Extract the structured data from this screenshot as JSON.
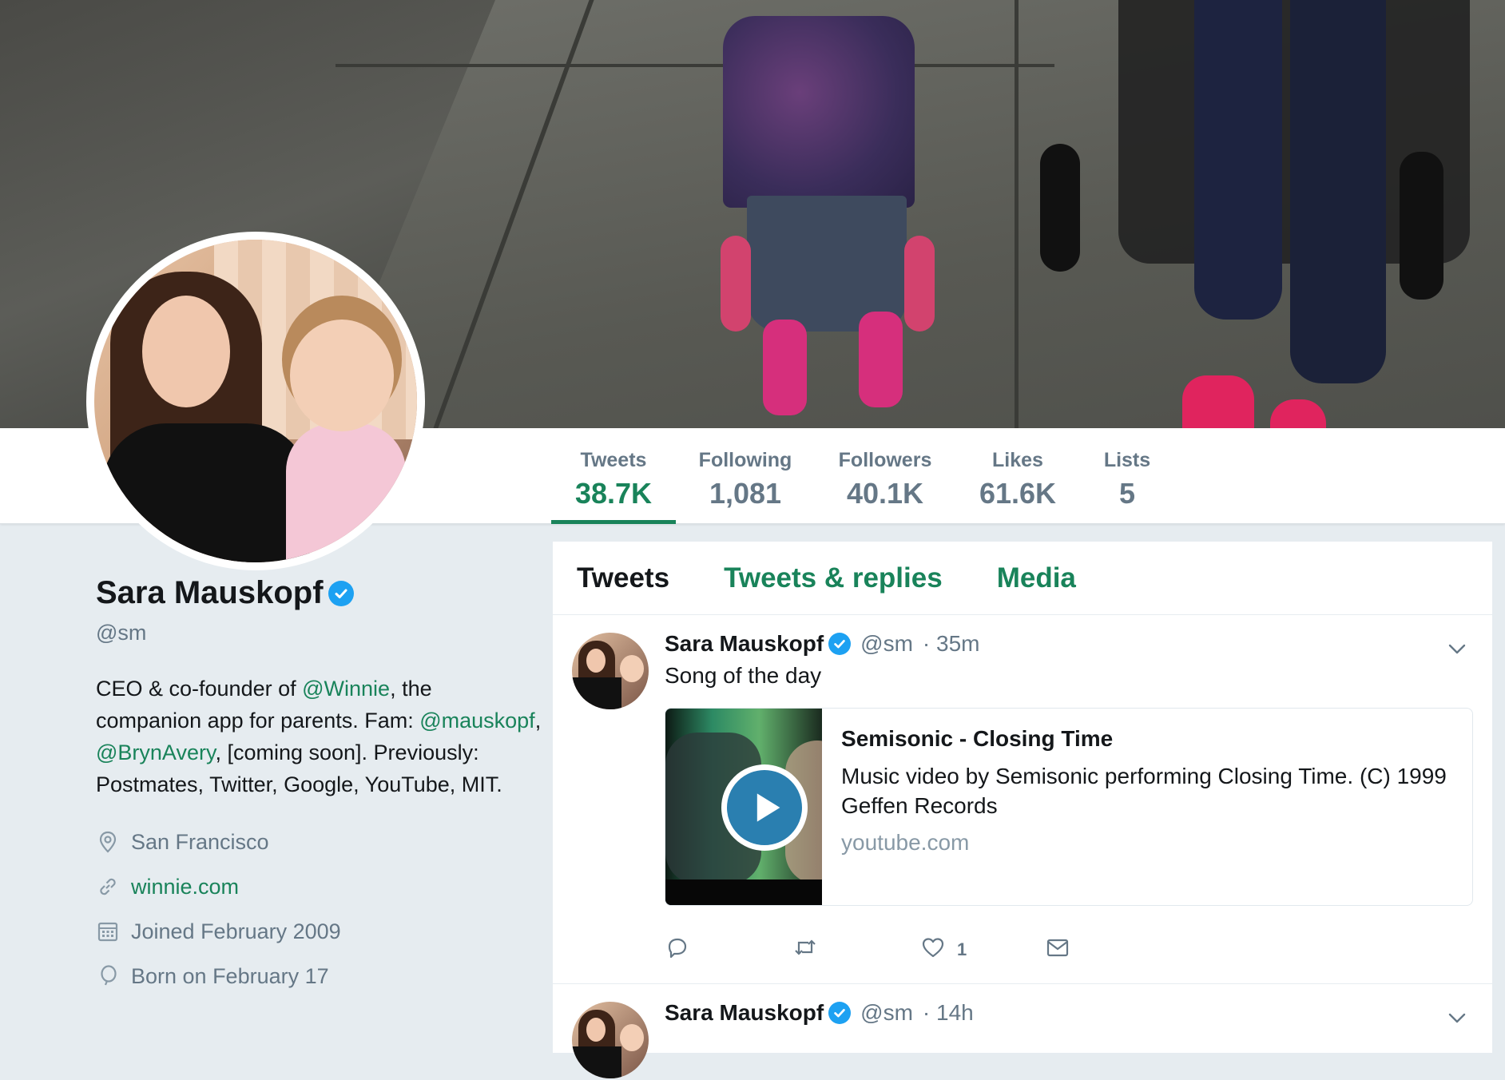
{
  "profile": {
    "name": "Sara Mauskopf",
    "handle": "@sm",
    "bio_parts": {
      "p1": "CEO & co-founder of ",
      "mention1": "@Winnie",
      "p2": ", the companion app for parents. Fam: ",
      "mention2": "@mauskopf",
      "p3": ", ",
      "mention3": "@BrynAvery",
      "p4": ", [coming soon]. Previously: Postmates, Twitter, Google, YouTube, MIT."
    },
    "location": "San Francisco",
    "website": "winnie.com",
    "joined": "Joined February 2009",
    "born": "Born on February 17"
  },
  "stats": [
    {
      "label": "Tweets",
      "value": "38.7K"
    },
    {
      "label": "Following",
      "value": "1,081"
    },
    {
      "label": "Followers",
      "value": "40.1K"
    },
    {
      "label": "Likes",
      "value": "61.6K"
    },
    {
      "label": "Lists",
      "value": "5"
    }
  ],
  "tabs": [
    "Tweets",
    "Tweets & replies",
    "Media"
  ],
  "tweets": [
    {
      "name": "Sara Mauskopf",
      "handle": "@sm",
      "time": "· 35m",
      "text": "Song of the day",
      "card": {
        "title": "Semisonic - Closing Time",
        "description": "Music video by Semisonic performing Closing Time. (C) 1999 Geffen Records",
        "domain": "youtube.com"
      },
      "like_count": "1"
    },
    {
      "name": "Sara Mauskopf",
      "handle": "@sm",
      "time": "· 14h"
    }
  ],
  "colors": {
    "accent": "#19835a",
    "verified": "#1da1f2",
    "muted": "#657786",
    "background": "#e6ecf0"
  },
  "icons": [
    "verified-badge-icon",
    "location-pin-icon",
    "link-icon",
    "calendar-icon",
    "balloon-icon",
    "chevron-down-icon",
    "reply-icon",
    "retweet-icon",
    "heart-icon",
    "envelope-icon",
    "play-icon"
  ]
}
